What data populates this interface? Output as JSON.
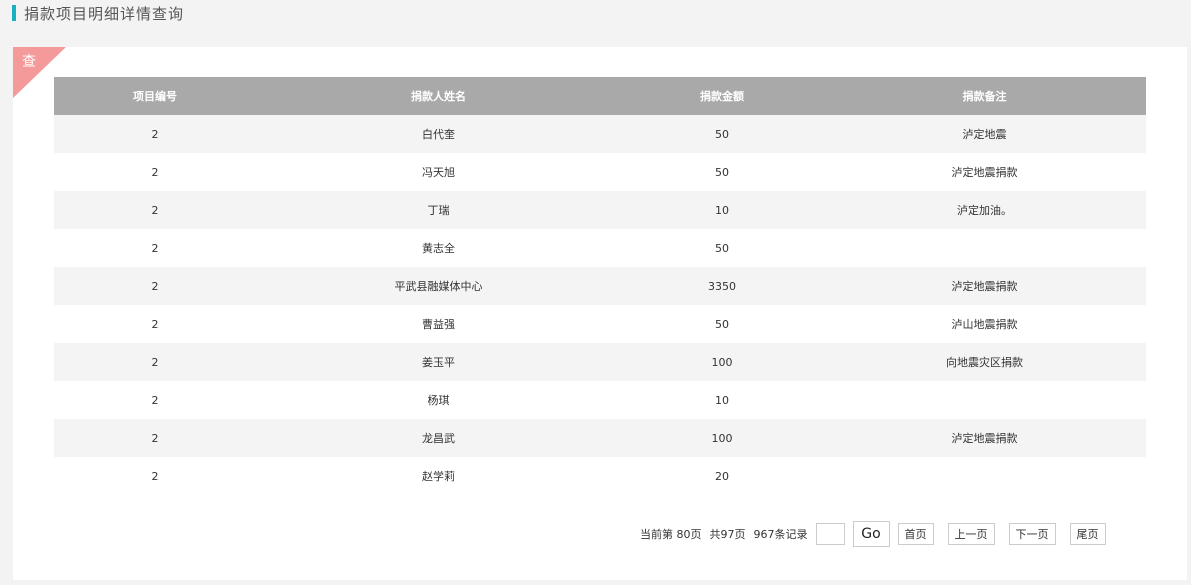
{
  "page": {
    "title": "捐款项目明细详情查询"
  },
  "panel": {
    "corner_label": "查"
  },
  "table": {
    "headers": [
      "项目编号",
      "捐款人姓名",
      "捐款金额",
      "捐款备注"
    ],
    "rows": [
      [
        "2",
        "白代奎",
        "50",
        "泸定地震"
      ],
      [
        "2",
        "冯天旭",
        "50",
        "泸定地震捐款"
      ],
      [
        "2",
        "丁瑞",
        "10",
        "泸定加油。"
      ],
      [
        "2",
        "黄志全",
        "50",
        ""
      ],
      [
        "2",
        "平武县融媒体中心",
        "3350",
        "泸定地震捐款"
      ],
      [
        "2",
        "曹益强",
        "50",
        "泸山地震捐款"
      ],
      [
        "2",
        "姜玉平",
        "100",
        "向地震灾区捐款"
      ],
      [
        "2",
        "杨琪",
        "10",
        ""
      ],
      [
        "2",
        "龙昌武",
        "100",
        "泸定地震捐款"
      ],
      [
        "2",
        "赵学莉",
        "20",
        ""
      ]
    ]
  },
  "pager": {
    "current_text": "当前第 80页",
    "total_pages_text": "共97页",
    "records_text": "967条记录",
    "page_input_value": "",
    "go_label": "Go",
    "first_label": "首页",
    "prev_label": "上一页",
    "next_label": "下一页",
    "last_label": "尾页"
  },
  "colors": {
    "accent": "#1ab0c4",
    "ribbon": "#f59a9a",
    "header_bg": "#a9a9a9"
  }
}
